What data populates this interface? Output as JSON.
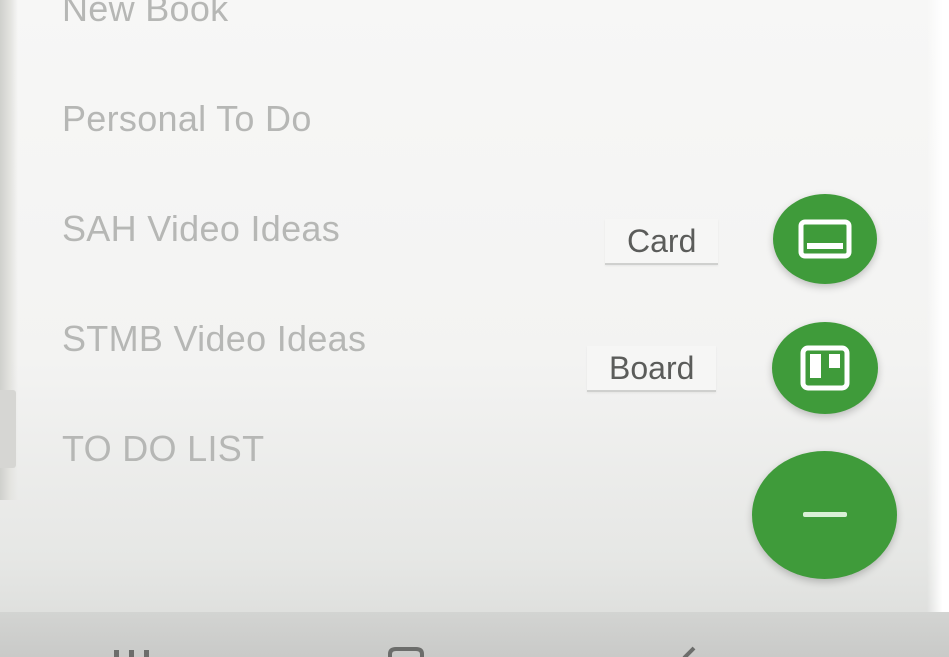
{
  "boards": [
    {
      "name": "New Book"
    },
    {
      "name": "Personal To Do"
    },
    {
      "name": "SAH Video Ideas"
    },
    {
      "name": "STMB Video Ideas"
    },
    {
      "name": "TO DO LIST"
    }
  ],
  "fab_menu": {
    "card": {
      "label": "Card",
      "icon": "card-icon"
    },
    "board": {
      "label": "Board",
      "icon": "board-icon"
    },
    "close": {
      "icon": "minus-icon"
    }
  },
  "nav_bar": {
    "icons": [
      "recent-apps-icon",
      "home-icon",
      "back-icon"
    ]
  },
  "colors": {
    "accent": "#3f9b3a",
    "list_text": "#b6b7b5",
    "label_text": "#5b5c5a"
  }
}
